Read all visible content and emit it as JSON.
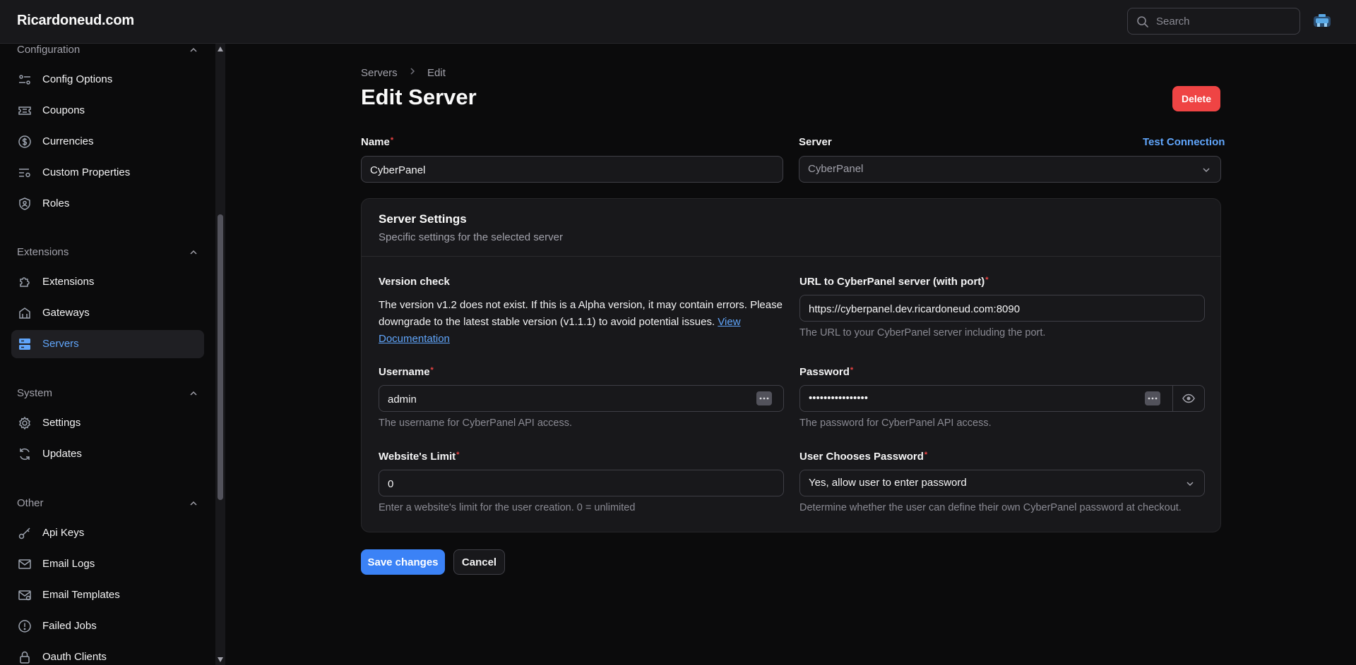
{
  "app": {
    "brand": "Ricardoneud.com"
  },
  "search": {
    "placeholder": "Search"
  },
  "sidebar": {
    "groups": [
      {
        "label": "Configuration",
        "items": [
          "Config Options",
          "Coupons",
          "Currencies",
          "Custom Properties",
          "Roles"
        ]
      },
      {
        "label": "Extensions",
        "items": [
          "Extensions",
          "Gateways",
          "Servers"
        ]
      },
      {
        "label": "System",
        "items": [
          "Settings",
          "Updates"
        ]
      },
      {
        "label": "Other",
        "items": [
          "Api Keys",
          "Email Logs",
          "Email Templates",
          "Failed Jobs",
          "Oauth Clients"
        ]
      }
    ],
    "active_item": "Servers"
  },
  "breadcrumb": {
    "items": [
      "Servers",
      "Edit"
    ]
  },
  "page": {
    "title": "Edit Server",
    "delete_label": "Delete",
    "test_connection_label": "Test Connection"
  },
  "form": {
    "name": {
      "label": "Name",
      "value": "CyberPanel"
    },
    "server": {
      "label": "Server",
      "value": "CyberPanel"
    }
  },
  "panel": {
    "title": "Server Settings",
    "subtitle": "Specific settings for the selected server",
    "version": {
      "label": "Version check",
      "text": "The version v1.2 does not exist. If this is a Alpha version, it may contain errors. Please downgrade to the latest stable version (v1.1.1) to avoid potential issues.",
      "link": "View Documentation"
    },
    "url": {
      "label": "URL to CyberPanel server (with port)",
      "value": "https://cyberpanel.dev.ricardoneud.com:8090",
      "help": "The URL to your CyberPanel server including the port."
    },
    "username": {
      "label": "Username",
      "value": "admin",
      "help": "The username for CyberPanel API access."
    },
    "password": {
      "label": "Password",
      "value": "••••••••••••••••",
      "help": "The password for CyberPanel API access."
    },
    "website_limit": {
      "label": "Website's Limit",
      "value": "0",
      "help": "Enter a website's limit for the user creation. 0 = unlimited"
    },
    "user_chooses_password": {
      "label": "User Chooses Password",
      "value": "Yes, allow user to enter password",
      "help": "Determine whether the user can define their own CyberPanel password at checkout."
    }
  },
  "actions": {
    "save_label": "Save changes",
    "cancel_label": "Cancel"
  },
  "colors": {
    "accent": "#3b82f6",
    "link": "#60a5fa",
    "danger": "#ef4444",
    "background": "#0b0b0c",
    "surface": "#18181b"
  }
}
